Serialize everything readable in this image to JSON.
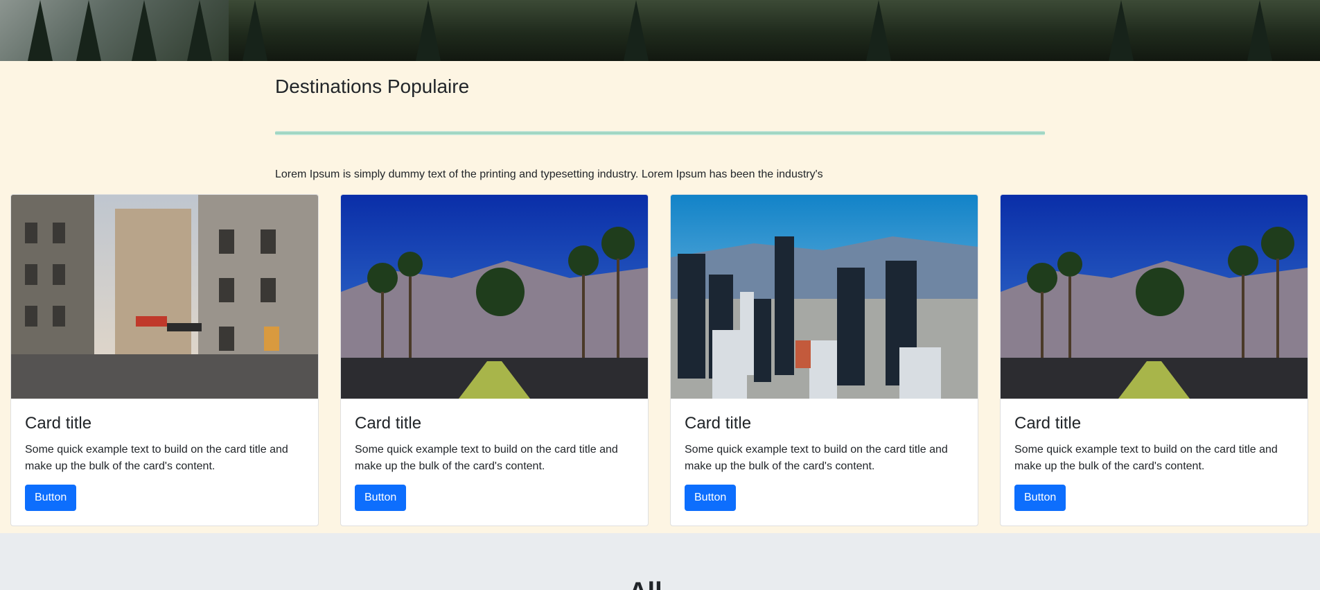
{
  "header": {
    "background_image": "forest-mountain-banner"
  },
  "destinations": {
    "title": "Destinations Populaire",
    "intro": "Lorem Ipsum is simply dummy text of the printing and typesetting industry. Lorem Ipsum has been the industry's",
    "cards": [
      {
        "image": "paris-street-photo",
        "title": "Card title",
        "text": "Some quick example text to build on the card title and make up the bulk of the card's content.",
        "button": "Button"
      },
      {
        "image": "palm-road-mountains-photo",
        "title": "Card title",
        "text": "Some quick example text to build on the card title and make up the bulk of the card's content.",
        "button": "Button"
      },
      {
        "image": "city-skyline-photo",
        "title": "Card title",
        "text": "Some quick example text to build on the card title and make up the bulk of the card's content.",
        "button": "Button"
      },
      {
        "image": "palm-road-mountains-photo",
        "title": "Card title",
        "text": "Some quick example text to build on the card title and make up the bulk of the card's content.",
        "button": "Button"
      }
    ]
  },
  "next_section": {
    "title": "All ..."
  },
  "colors": {
    "accent": "#0d6efd",
    "section_bg": "#fdf5e3",
    "bottom_bg": "#e9ecef",
    "divider": "#8fcfb9"
  }
}
